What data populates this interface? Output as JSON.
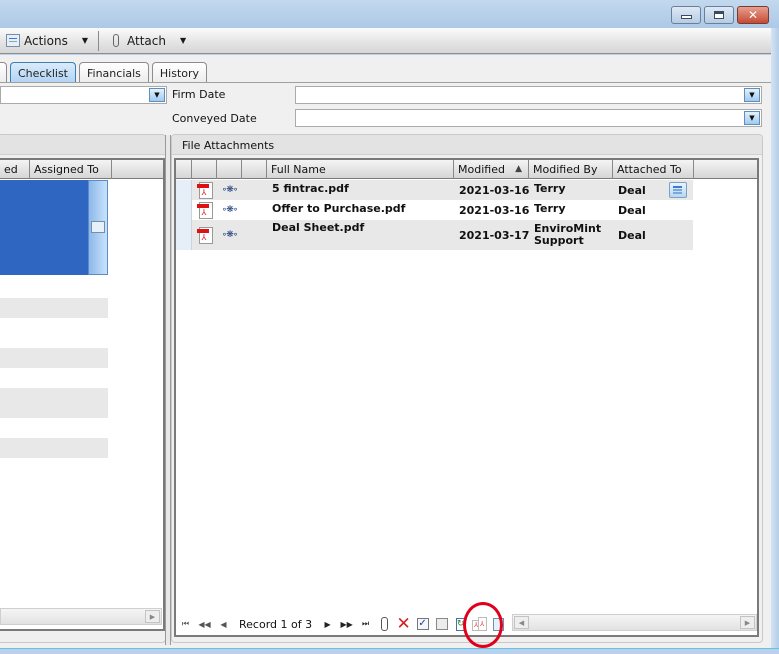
{
  "window": {
    "controls": {
      "minimize": "minimize",
      "maximize": "maximize",
      "close": "close"
    }
  },
  "toolbar": {
    "actions_label": "Actions",
    "attach_label": "Attach",
    "actions_icon": "actions-icon",
    "attach_icon": "paperclip-icon"
  },
  "tabs": [
    {
      "label": "Checklist",
      "active": true
    },
    {
      "label": "Financials",
      "active": false
    },
    {
      "label": "History",
      "active": false
    }
  ],
  "form": {
    "left_combo_value": "",
    "firm_date_label": "Firm Date",
    "firm_date_value": "",
    "conveyed_date_label": "Conveyed Date",
    "conveyed_date_value": ""
  },
  "left_grid": {
    "columns": [
      "ed",
      "Assigned To",
      ""
    ]
  },
  "attachments": {
    "title": "File Attachments",
    "columns": [
      "",
      "",
      "",
      "Full Name",
      "Modified",
      "Modified By",
      "Attached To",
      ""
    ],
    "sort": {
      "column": "Modified",
      "direction": "asc"
    },
    "rows": [
      {
        "full_name": "5 fintrac.pdf",
        "modified": "2021-03-16",
        "modified_by": "Terry",
        "attached_to": "Deal"
      },
      {
        "full_name": "Offer to Purchase.pdf",
        "modified": "2021-03-16",
        "modified_by": "Terry",
        "attached_to": "Deal"
      },
      {
        "full_name": "Deal Sheet.pdf",
        "modified": "2021-03-17",
        "modified_by": "EnviroMint Support",
        "attached_to": "Deal"
      }
    ],
    "navigator": {
      "record_text": "Record 1 of 3",
      "current": 1,
      "total": 3
    }
  }
}
